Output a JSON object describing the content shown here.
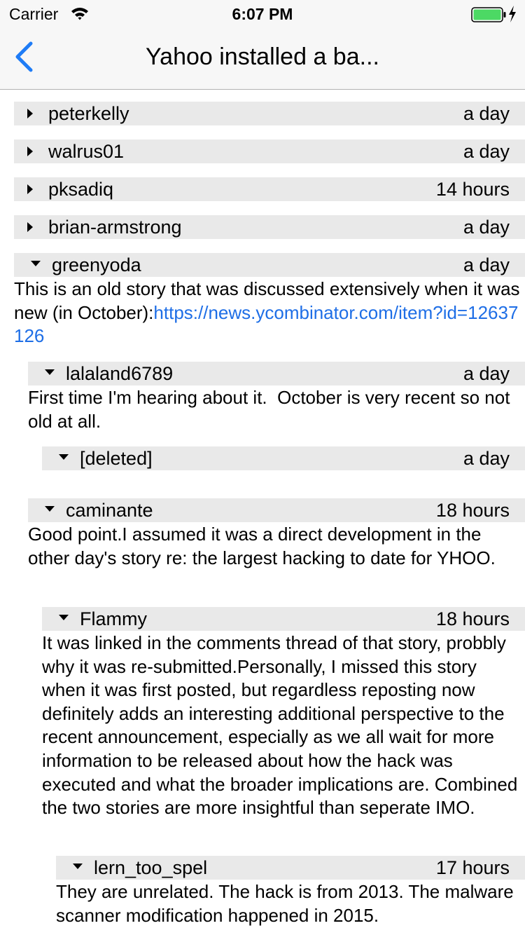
{
  "status_bar": {
    "carrier": "Carrier",
    "time": "6:07 PM"
  },
  "nav": {
    "title": "Yahoo installed a ba..."
  },
  "comments": [
    {
      "author": "peterkelly",
      "age": "a day",
      "collapsed": true
    },
    {
      "author": "walrus01",
      "age": "a day",
      "collapsed": true
    },
    {
      "author": "pksadiq",
      "age": "14 hours",
      "collapsed": true
    },
    {
      "author": "brian-armstrong",
      "age": "a day",
      "collapsed": true
    },
    {
      "author": "greenyoda",
      "age": "a day",
      "collapsed": false,
      "text": "This is an old story that was discussed extensively when it was new (in October):",
      "link": "https://news.ycombinator.com/item?id=12637126"
    },
    {
      "author": "lalaland6789",
      "age": "a day",
      "collapsed": false,
      "text": "First time I'm hearing about it.  October is very recent so not old at all."
    },
    {
      "author": "[deleted]",
      "age": "a day",
      "collapsed": false
    },
    {
      "author": "caminante",
      "age": "18 hours",
      "collapsed": false,
      "text": "Good point.I assumed it was a direct development in the other day's story re: the largest hacking to date for YHOO."
    },
    {
      "author": "Flammy",
      "age": "18 hours",
      "collapsed": false,
      "text": "It was linked in the comments thread of that story, probbly why it was re-submitted.Personally, I missed this story when it was first posted, but regardless reposting now definitely adds an interesting additional perspective to the recent announcement, especially as we all wait for more information to be released about how the hack was executed and what the broader implications are. Combined the two stories are more insightful than seperate IMO."
    },
    {
      "author": "lern_too_spel",
      "age": "17 hours",
      "collapsed": false,
      "text": "They are unrelated. The hack is from 2013. The malware scanner modification happened in 2015."
    }
  ]
}
